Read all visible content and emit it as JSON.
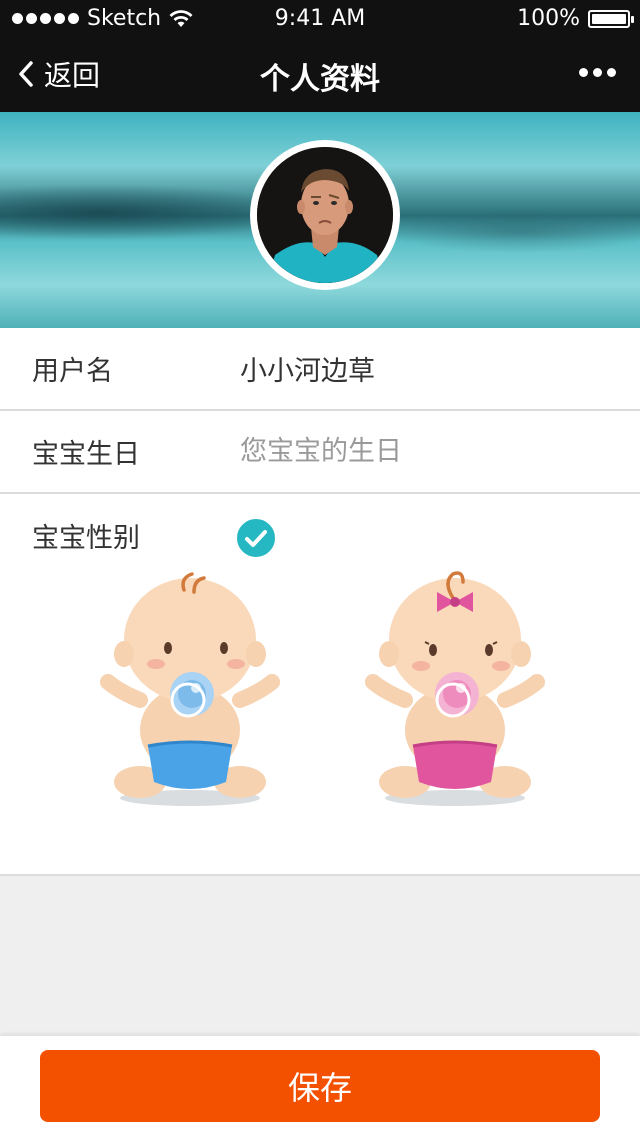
{
  "status_bar": {
    "carrier": "Sketch",
    "time": "9:41 AM",
    "battery": "100%"
  },
  "nav": {
    "back_label": "返回",
    "title": "个人资料"
  },
  "form": {
    "username_label": "用户名",
    "username_value": "小小河边草",
    "birthday_label": "宝宝生日",
    "birthday_placeholder": "您宝宝的生日",
    "gender_label": "宝宝性别",
    "gender_selected": "boy"
  },
  "footer": {
    "save_label": "保存"
  },
  "colors": {
    "accent": "#f35000",
    "check": "#25b8c2",
    "navbar": "#111111"
  }
}
